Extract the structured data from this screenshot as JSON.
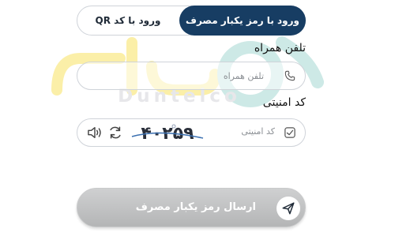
{
  "tabs": {
    "password_login": "ورود با رمز یکبار مصرف",
    "qr_login": "ورود با کد QR"
  },
  "phone": {
    "label": "تلفن همراه",
    "placeholder": "تلفن همراه",
    "icon": "phone-icon"
  },
  "security": {
    "label": "کد امنیتی",
    "placeholder": "کد امنیتی",
    "captcha_digits": "۴۰۲۵۹",
    "icons": [
      "check-icon",
      "refresh-icon",
      "speaker-icon"
    ]
  },
  "submit": {
    "label": "ارسال رمز یکبار مصرف",
    "icon": "send-icon"
  },
  "watermark": {
    "logo_text": "دانلکو",
    "brand_text": "Duntelco"
  },
  "colors": {
    "primary": "#173d63",
    "button_gray": "#c2c3c4",
    "watermark_yellow": "#fbefa8",
    "watermark_teal": "#cde9e6"
  }
}
